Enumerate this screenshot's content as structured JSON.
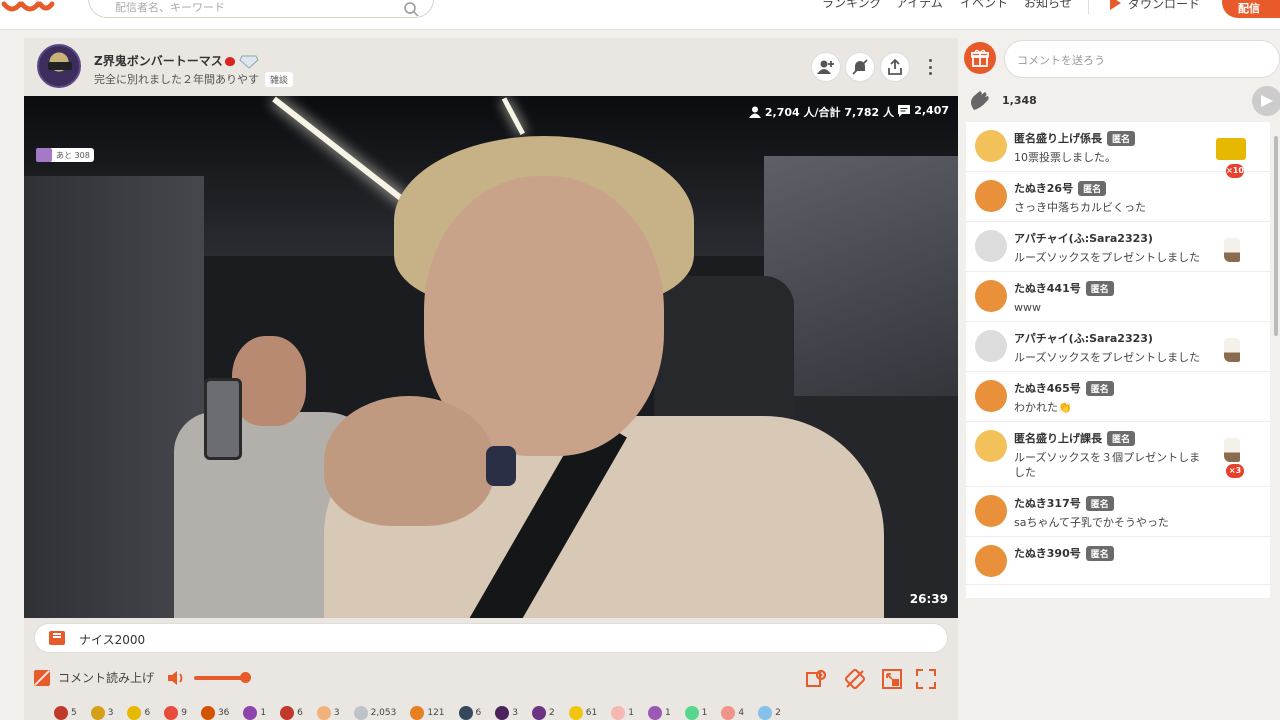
{
  "header": {
    "search_placeholder": "配信者名、キーワード",
    "nav": [
      "ランキング",
      "アイテム",
      "イベント",
      "お知らせ"
    ],
    "download_label": "ダウンロード",
    "live_label": "配信"
  },
  "stream": {
    "streamer_name": "Z界鬼ボンバートーマス",
    "title": "完全に別れました２年間ありやす",
    "category": "雑談",
    "viewers": "2,704 人/合計 7,782 人",
    "comment_count": "2,407",
    "event_chip": "あと 308",
    "elapsed": "26:39"
  },
  "comment_bar": {
    "text": "ナイス2000"
  },
  "controls": {
    "read_aloud_label": "コメント読み上げ",
    "volume": 0.85
  },
  "gifts": [
    {
      "count": "5",
      "color": "#c0392b"
    },
    {
      "count": "3",
      "color": "#d4a017"
    },
    {
      "count": "6",
      "color": "#e6b800"
    },
    {
      "count": "9",
      "color": "#e74c3c"
    },
    {
      "count": "36",
      "color": "#d35400"
    },
    {
      "count": "1",
      "color": "#8e44ad"
    },
    {
      "count": "6",
      "color": "#c0392b"
    },
    {
      "count": "3",
      "color": "#f0b27a"
    },
    {
      "count": "2,053",
      "color": "#bdc3c7"
    },
    {
      "count": "121",
      "color": "#e67e22"
    },
    {
      "count": "6",
      "color": "#34495e"
    },
    {
      "count": "3",
      "color": "#4a235a"
    },
    {
      "count": "2",
      "color": "#6c3483"
    },
    {
      "count": "61",
      "color": "#f1c40f"
    },
    {
      "count": "1",
      "color": "#f5b7b1"
    },
    {
      "count": "1",
      "color": "#9b59b6"
    },
    {
      "count": "1",
      "color": "#58d68d"
    },
    {
      "count": "4",
      "color": "#f1948a"
    },
    {
      "count": "2",
      "color": "#85c1e9"
    }
  ],
  "chat": {
    "input_placeholder": "コメントを送ろう",
    "hands_count": "1,348",
    "anon_label": "匿名",
    "items": [
      {
        "name": "匿名盛り上げ係長",
        "anon": true,
        "text": "10票投票しました。",
        "mult": "×10",
        "avatar": "#f3c15a"
      },
      {
        "name": "たぬき26号",
        "anon": true,
        "text": "さっき中落ちカルビくった",
        "mult": "",
        "avatar": "#e8913a"
      },
      {
        "name": "アパチャイ(ふ:Sara2323)",
        "anon": false,
        "text": "ルーズソックスをプレゼントしました",
        "mult": "",
        "avatar": "#dcdcdc"
      },
      {
        "name": "たぬき441号",
        "anon": true,
        "text": "www",
        "mult": "",
        "avatar": "#e8913a"
      },
      {
        "name": "アパチャイ(ふ:Sara2323)",
        "anon": false,
        "text": "ルーズソックスをプレゼントしました",
        "mult": "",
        "avatar": "#dcdcdc"
      },
      {
        "name": "たぬき465号",
        "anon": true,
        "text": "わかれた👏",
        "mult": "",
        "avatar": "#e8913a"
      },
      {
        "name": "匿名盛り上げ課長",
        "anon": true,
        "text": "ルーズソックスを３個プレゼントしました",
        "mult": "×3",
        "avatar": "#f3c15a"
      },
      {
        "name": "たぬき317号",
        "anon": true,
        "text": "saちゃんて子乳でかそうやった",
        "mult": "",
        "avatar": "#e8913a"
      },
      {
        "name": "たぬき390号",
        "anon": true,
        "text": "",
        "mult": "",
        "avatar": "#e8913a"
      }
    ]
  },
  "colors": {
    "accent": "#e85a2a",
    "panel_bg": "#eae6e1"
  }
}
